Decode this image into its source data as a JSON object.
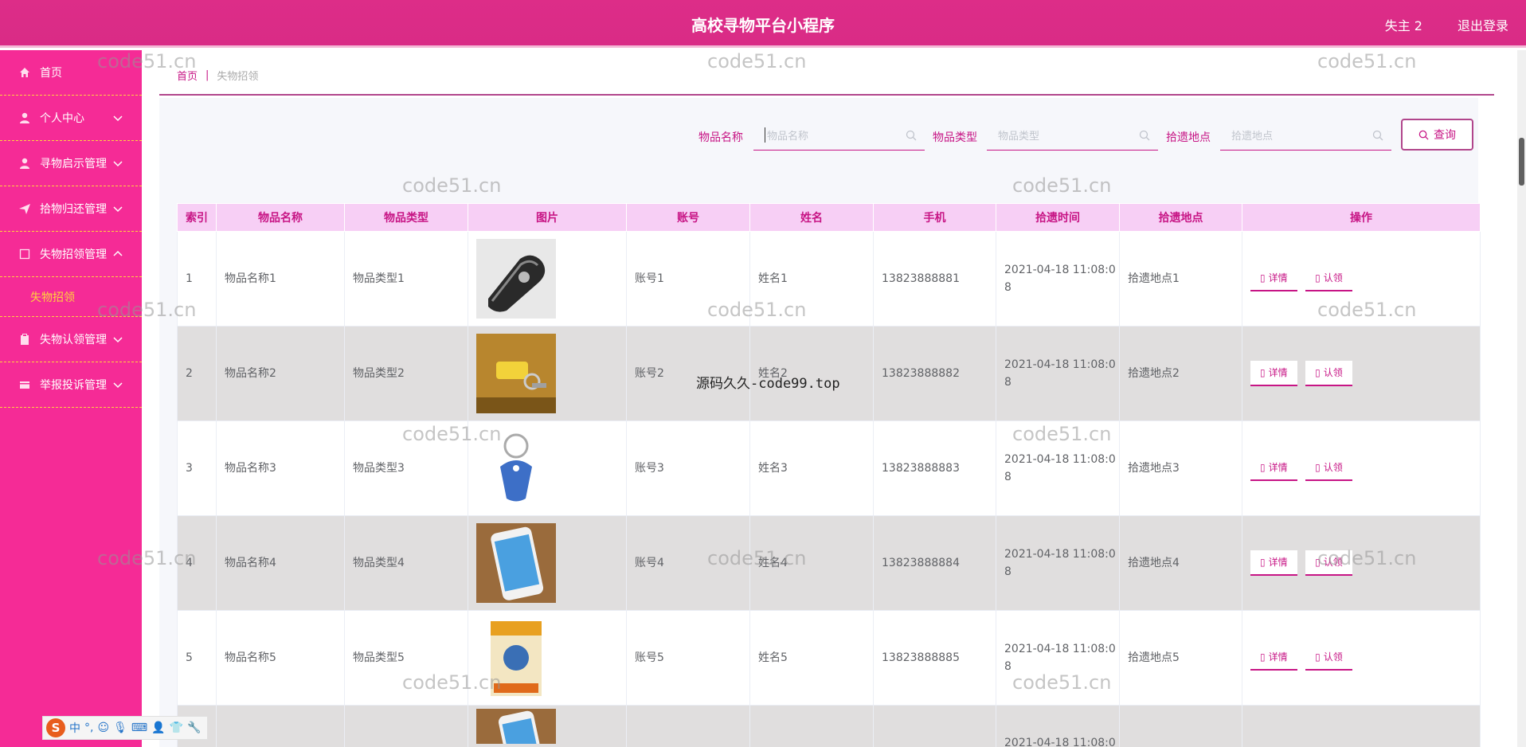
{
  "header": {
    "title": "高校寻物平台小程序",
    "user": "失主 2",
    "logout": "退出登录"
  },
  "sidebar": {
    "items": [
      {
        "label": "首页",
        "icon": "home-icon"
      },
      {
        "label": "个人中心",
        "icon": "user-icon"
      },
      {
        "label": "寻物启示管理",
        "icon": "user-icon"
      },
      {
        "label": "拾物归还管理",
        "icon": "send-icon"
      },
      {
        "label": "失物招领管理",
        "icon": "square-icon"
      },
      {
        "label": "失物认领管理",
        "icon": "clipboard-icon"
      },
      {
        "label": "举报投诉管理",
        "icon": "card-icon"
      }
    ],
    "sub_item": "失物招领"
  },
  "breadcrumb": {
    "home": "首页",
    "sep": "|",
    "current": "失物招领"
  },
  "search": {
    "name_label": "物品名称",
    "name_placeholder": "物品名称",
    "type_label": "物品类型",
    "type_placeholder": "物品类型",
    "place_label": "拾遗地点",
    "place_placeholder": "拾遗地点",
    "button": "查询"
  },
  "table": {
    "columns": [
      "索引",
      "物品名称",
      "物品类型",
      "图片",
      "账号",
      "姓名",
      "手机",
      "拾遗时间",
      "拾遗地点",
      "操作"
    ],
    "detail_label": "详情",
    "claim_label": "认领",
    "rows": [
      {
        "index": "1",
        "name": "物品名称1",
        "type": "物品类型1",
        "account": "账号1",
        "person": "姓名1",
        "phone": "13823888881",
        "time": "2021-04-18 11:08:0\n8",
        "place": "拾遗地点1"
      },
      {
        "index": "2",
        "name": "物品名称2",
        "type": "物品类型2",
        "account": "账号2",
        "person": "姓名2",
        "phone": "13823888882",
        "time": "2021-04-18 11:08:0\n8",
        "place": "拾遗地点2"
      },
      {
        "index": "3",
        "name": "物品名称3",
        "type": "物品类型3",
        "account": "账号3",
        "person": "姓名3",
        "phone": "13823888883",
        "time": "2021-04-18 11:08:0\n8",
        "place": "拾遗地点3"
      },
      {
        "index": "4",
        "name": "物品名称4",
        "type": "物品类型4",
        "account": "账号4",
        "person": "姓名4",
        "phone": "13823888884",
        "time": "2021-04-18 11:08:0\n8",
        "place": "拾遗地点4"
      },
      {
        "index": "5",
        "name": "物品名称5",
        "type": "物品类型5",
        "account": "账号5",
        "person": "姓名5",
        "phone": "13823888885",
        "time": "2021-04-18 11:08:0\n8",
        "place": "拾遗地点5"
      },
      {
        "index": "",
        "name": "",
        "type": "",
        "account": "",
        "person": "",
        "phone": "",
        "time": "2021-04-18 11:08:0",
        "place": ""
      }
    ]
  },
  "watermark": {
    "text": "code51.cn",
    "overlay": "源码久久-code99.top"
  },
  "ime": {
    "logo": "S",
    "mode": "中"
  },
  "colors": {
    "header": "#d92b86",
    "sidebar": "#f52b96",
    "accent": "#c71585",
    "submenu": "#ffd33d",
    "table_header": "#f7cff5"
  }
}
